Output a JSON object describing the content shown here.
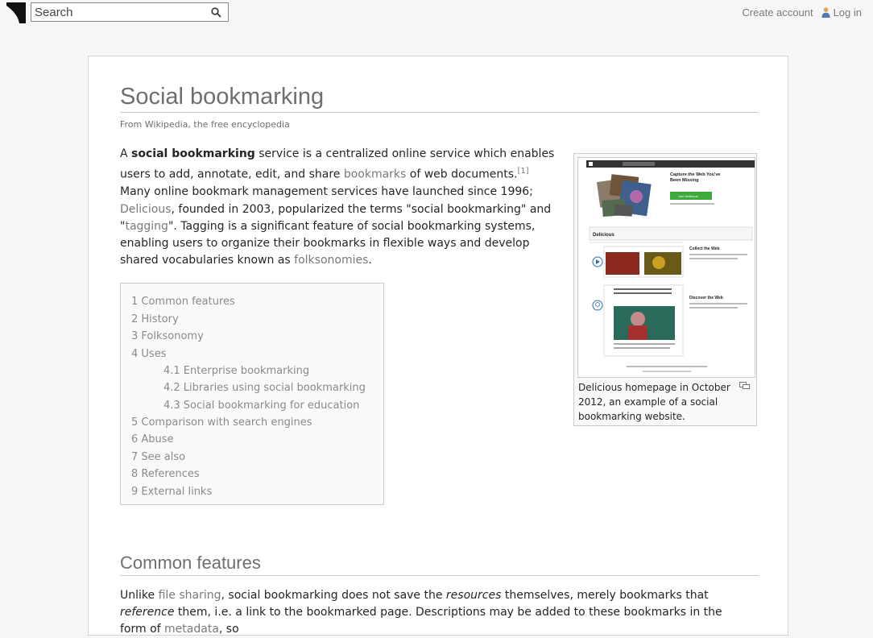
{
  "header": {
    "search_placeholder": "Search",
    "create_account": "Create account",
    "log_in": "Log in"
  },
  "article": {
    "title": "Social bookmarking",
    "tagline": "From Wikipedia, the free encyclopedia",
    "lead": {
      "p1": "A ",
      "bold": "social bookmarking",
      "p2": " service is a centralized online service which enables users to add, annotate, edit, and share ",
      "link_bookmarks": "bookmarks",
      "p3": " of web documents.",
      "ref1": "[1]",
      "p4": " Many online bookmark management services have launched since 1996; ",
      "link_delicious": "Delicious",
      "p5": ", founded in 2003, popularized the terms \"social bookmarking\" and \"",
      "link_tagging": "tagging",
      "p6": "\". Tagging is a significant feature of social bookmarking systems, enabling users to organize their bookmarks in flexible ways and develop shared vocabularies known as ",
      "link_folksonomies": "folksonomies",
      "p7": "."
    },
    "thumb": {
      "caption": "Delicious homepage in October 2012, an example of a social bookmarking website.",
      "screenshot": {
        "headline": "Capture the Web You've Been Missing",
        "join_button": "Join Delicious",
        "site_name": "Delicious",
        "collect_heading": "Collect the Web",
        "discover_heading": "Discover the Web"
      }
    },
    "toc": [
      {
        "label": "1 Common features",
        "level": 1
      },
      {
        "label": "2 History",
        "level": 1
      },
      {
        "label": "3 Folksonomy",
        "level": 1
      },
      {
        "label": "4 Uses",
        "level": 1
      },
      {
        "label": "4.1 Enterprise bookmarking",
        "level": 2
      },
      {
        "label": "4.2 Libraries using social bookmarking",
        "level": 2
      },
      {
        "label": "4.3 Social bookmarking for education",
        "level": 2
      },
      {
        "label": "5 Comparison with search engines",
        "level": 1
      },
      {
        "label": "6 Abuse",
        "level": 1
      },
      {
        "label": "7 See also",
        "level": 1
      },
      {
        "label": "8 References",
        "level": 1
      },
      {
        "label": "9 External links",
        "level": 1
      }
    ],
    "section1": {
      "heading": "Common features",
      "p1": "Unlike ",
      "link_file_sharing": "file sharing",
      "p2": ", social bookmarking does not save the ",
      "em_resources": "resources",
      "p3": " themselves, merely bookmarks that ",
      "em_reference": "reference",
      "p4": " them, i.e. a link to the bookmarked page. Descriptions may be added to these bookmarks in the form of ",
      "link_metadata": "metadata",
      "p5": ", so"
    }
  }
}
